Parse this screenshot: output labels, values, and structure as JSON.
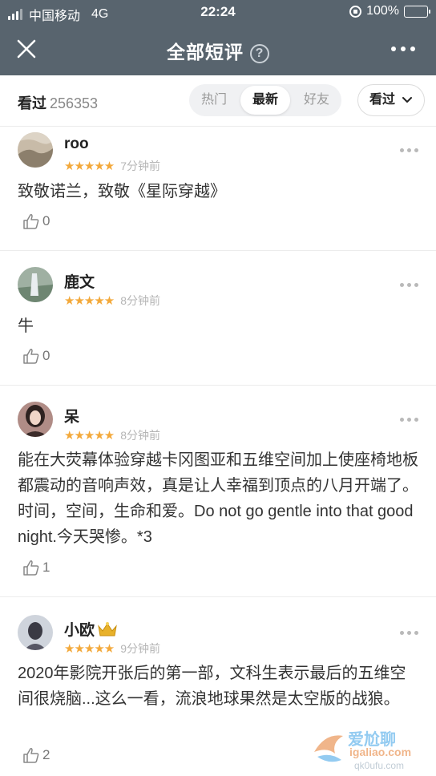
{
  "status_bar": {
    "carrier": "中国移动",
    "network": "4G",
    "time": "22:24",
    "battery": "100%"
  },
  "nav": {
    "title": "全部短评",
    "help_glyph": "?",
    "close_icon": "close-icon",
    "more_icon": "more-horizontal-icon"
  },
  "filter": {
    "seen_label": "看过",
    "seen_count": "256353",
    "tabs": [
      "热门",
      "最新",
      "好友"
    ],
    "active_tab": "最新",
    "dropdown_label": "看过"
  },
  "reviews": [
    {
      "user": "roo",
      "rating": 5,
      "time": "7分钟前",
      "text": "致敬诺兰，致敬《星际穿越》",
      "likes": "0"
    },
    {
      "user": "鹿文",
      "rating": 5,
      "time": "8分钟前",
      "text": "牛",
      "likes": "0"
    },
    {
      "user": "呆",
      "rating": 5,
      "time": "8分钟前",
      "text": "能在大荧幕体验穿越卡冈图亚和五维空间加上使座椅地板都震动的音响声效，真是让人幸福到顶点的八月开端了。时间，空间，生命和爱。Do not go gentle into that good night.今天哭惨。*3",
      "likes": "1"
    },
    {
      "user": "小欧",
      "rating": 5,
      "time": "9分钟前",
      "text": "2020年影院开张后的第一部，文科生表示最后的五维空间很烧脑...这么一看，流浪地球果然是太空版的战狼。",
      "likes": "2"
    }
  ],
  "watermark": {
    "line1": "爱尬聊",
    "line2": "igaliao.com",
    "line3": "qk0ufu.com"
  },
  "colors": {
    "header_bg": "#58646e",
    "star": "#f3a93b",
    "battery_fill": "#4cd964"
  }
}
